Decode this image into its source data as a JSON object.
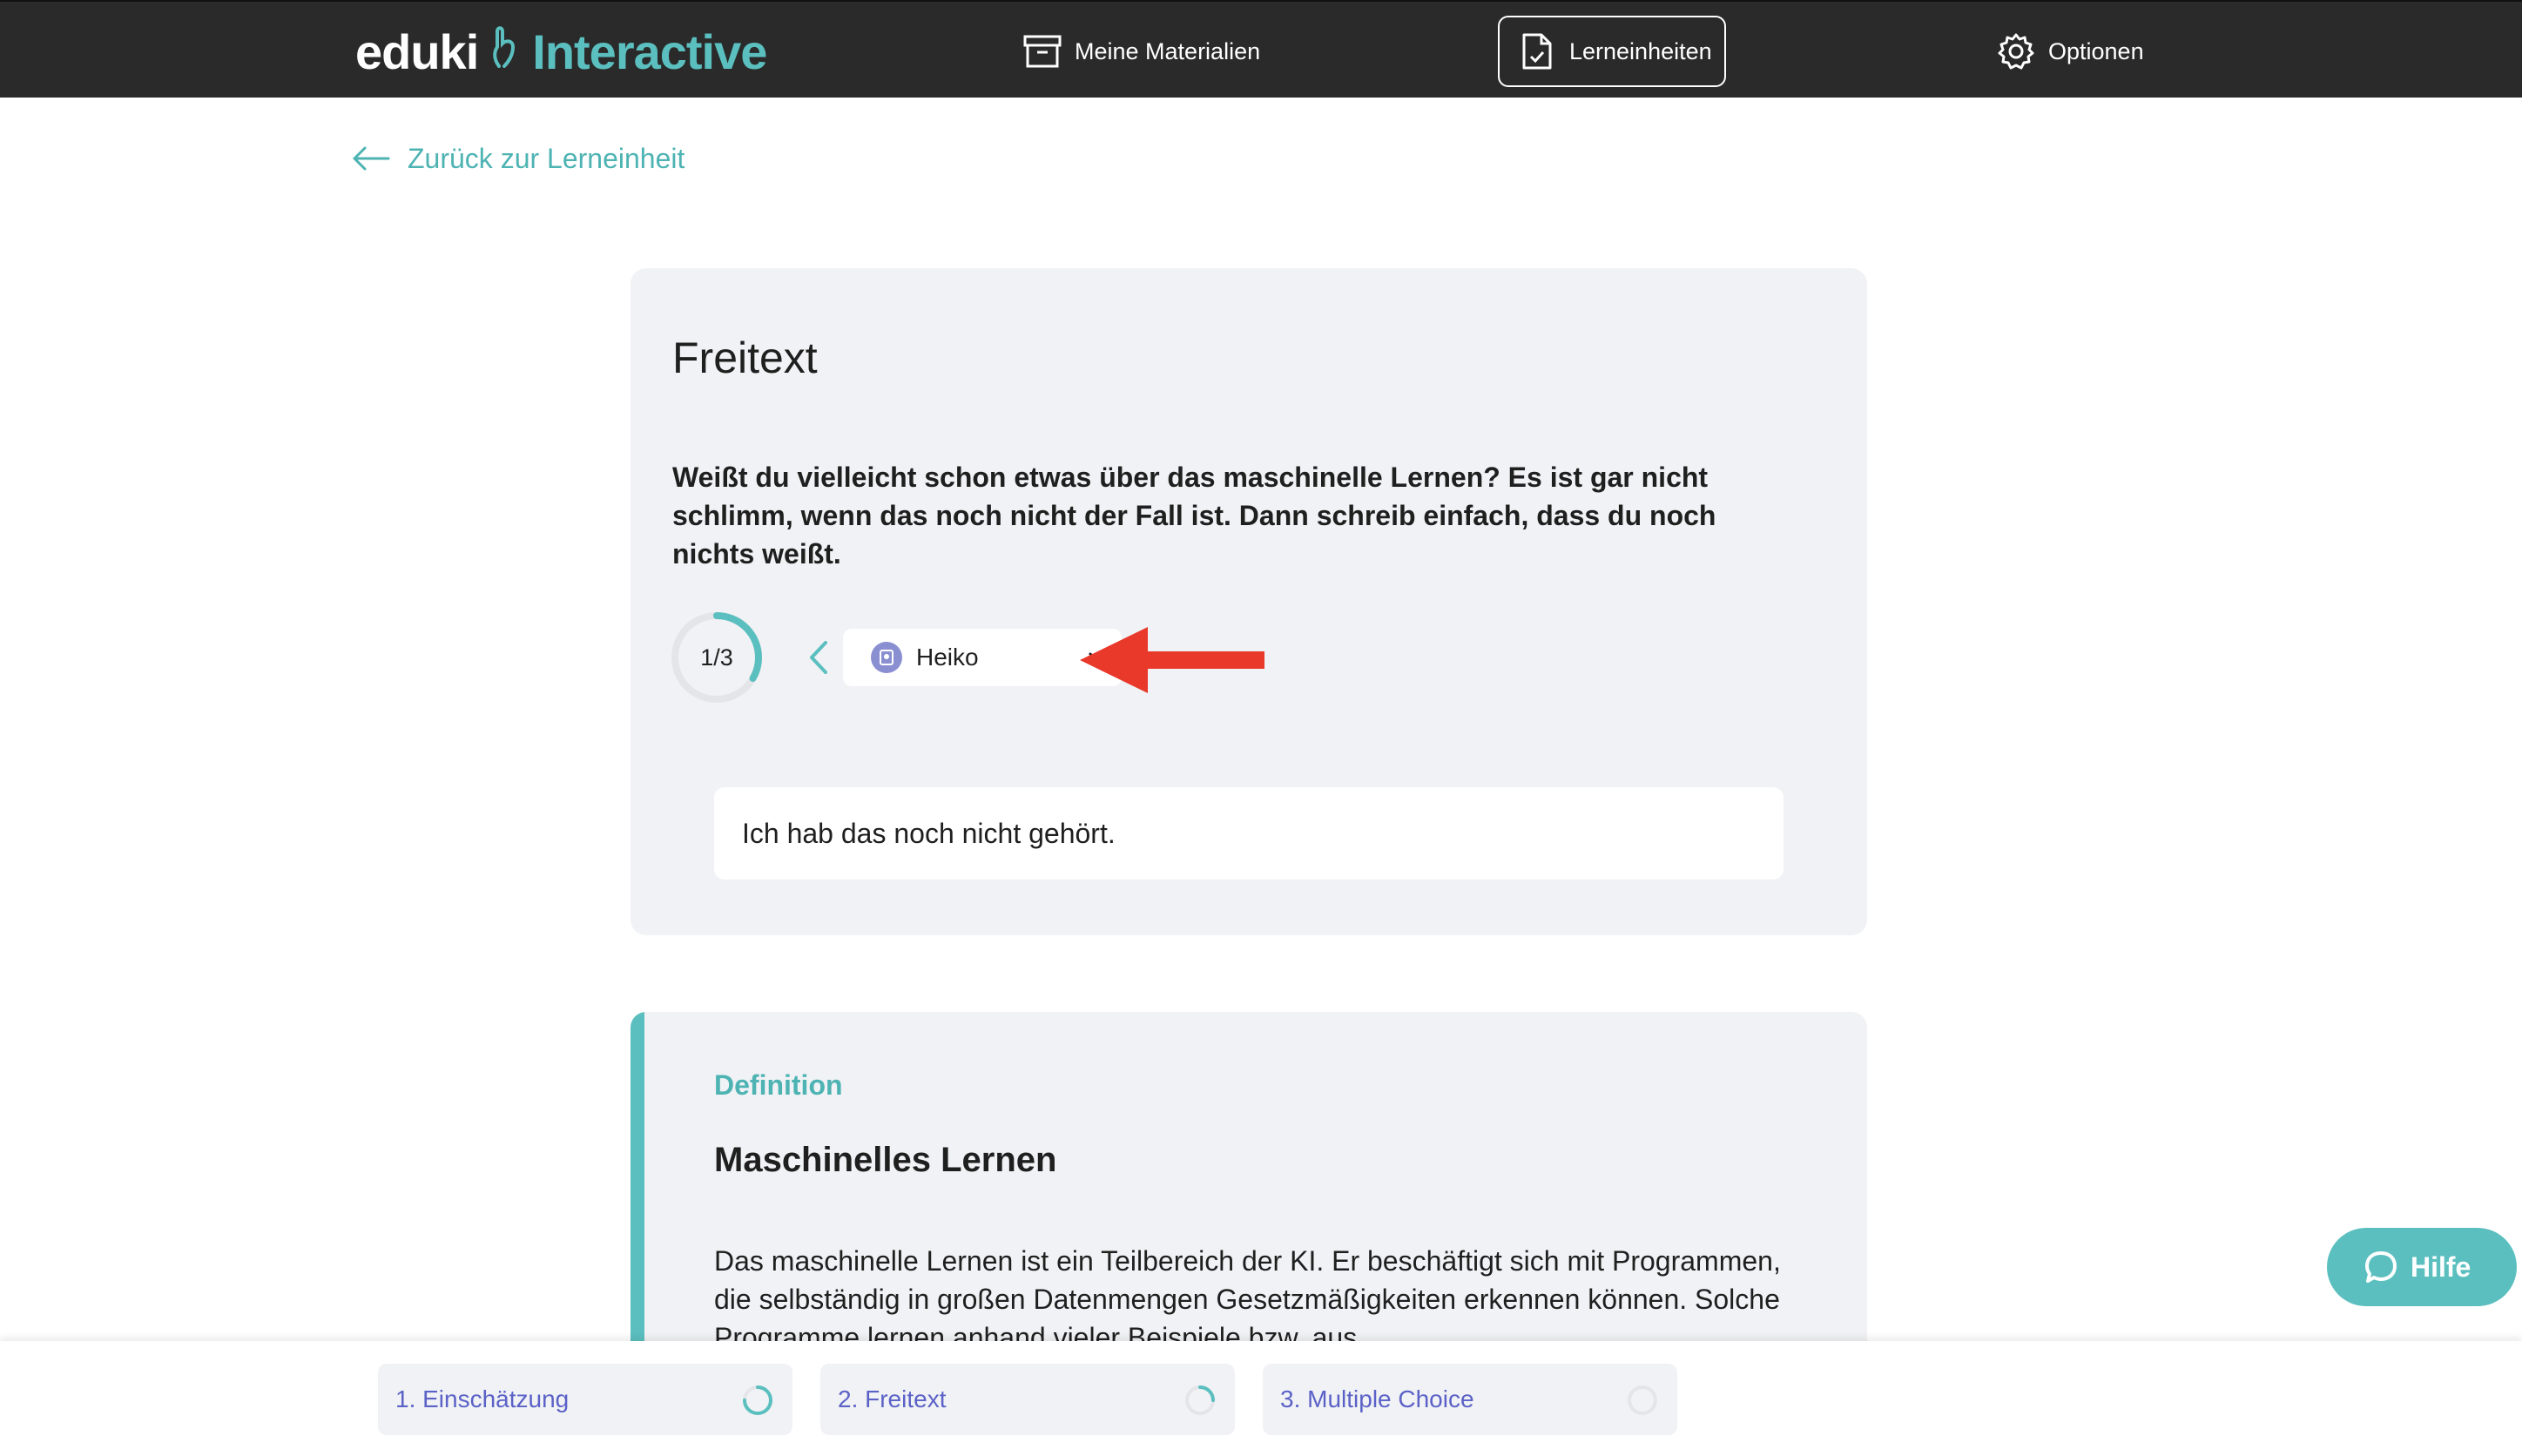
{
  "nav": {
    "logo_brand": "eduki",
    "logo_product": "Interactive",
    "items": [
      {
        "label": "Meine Materialien",
        "icon": "archive-box-icon"
      },
      {
        "label": "Lerneinheiten",
        "icon": "document-check-icon",
        "active": true
      },
      {
        "label": "Optionen",
        "icon": "gear-icon"
      }
    ]
  },
  "back_link": "Zurück zur Lerneinheit",
  "task": {
    "title": "Freitext",
    "question": "Weißt du vielleicht schon etwas über das maschinelle Lernen? Es ist gar nicht schlimm, wenn das noch nicht der Fall ist. Dann schreib einfach, dass du noch nichts weißt.",
    "progress_label": "1/3",
    "progress_fraction": 0.333,
    "selected_student": "Heiko",
    "answer": "Ich hab das noch nicht gehört."
  },
  "definition": {
    "label": "Definition",
    "title": "Maschinelles Lernen",
    "body": "Das maschinelle Lernen ist ein Teilbereich der KI. Er beschäftigt sich mit Programmen, die selbständig in großen Datenmengen Gesetzmäßigkeiten erkennen können. Solche Programme lernen anhand vieler Beispiele bzw. aus"
  },
  "help_button": "Hilfe",
  "steps": [
    {
      "label": "1. Einschätzung",
      "progress": 0.75
    },
    {
      "label": "2. Freitext",
      "progress": 0.25
    },
    {
      "label": "3. Multiple Choice",
      "progress": 0
    }
  ],
  "colors": {
    "accent": "#5bbfbf",
    "nav_bg": "#2a2a2a",
    "card_bg": "#f1f2f5",
    "step_text": "#5b62c7",
    "annotation_arrow": "#e8392b"
  }
}
